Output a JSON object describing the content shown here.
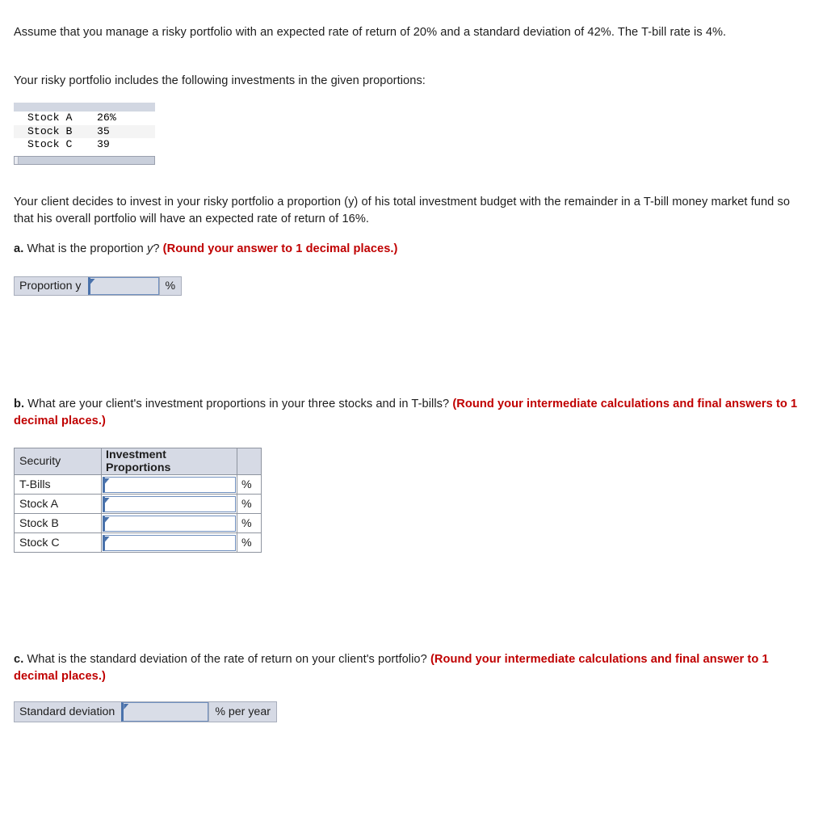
{
  "intro": {
    "paragraph1": "Assume that you manage a risky portfolio with an expected rate of return of 20% and a standard deviation of 42%. The T-bill rate is 4%.",
    "paragraph2": "Your risky portfolio includes the following investments in the given proportions:"
  },
  "portfolio_table": {
    "rows": [
      {
        "name": "Stock A",
        "value": "26%"
      },
      {
        "name": "Stock B",
        "value": "35"
      },
      {
        "name": "Stock C",
        "value": "39"
      }
    ]
  },
  "client_paragraph": "Your client decides to invest in your risky portfolio a proportion (y) of his total investment budget with the remainder in a T-bill money market fund so that his overall portfolio will have an expected rate of return of 16%.",
  "question_a": {
    "marker": "a.",
    "text_before": " What is the proportion ",
    "variable": "y",
    "text_after": "? ",
    "note": "(Round your answer to 1 decimal places.)",
    "answer": {
      "label": "Proportion y",
      "value": "",
      "unit": "%"
    }
  },
  "question_b": {
    "marker": "b.",
    "text": " What are your client's investment proportions in your three stocks and in T-bills? ",
    "note": "(Round your intermediate calculations and final answers to 1 decimal places.)",
    "table": {
      "headers": [
        "Security",
        "Investment Proportions",
        ""
      ],
      "rows": [
        {
          "security": "T-Bills",
          "proportion": "",
          "unit": "%"
        },
        {
          "security": "Stock A",
          "proportion": "",
          "unit": "%"
        },
        {
          "security": "Stock B",
          "proportion": "",
          "unit": "%"
        },
        {
          "security": "Stock C",
          "proportion": "",
          "unit": "%"
        }
      ]
    }
  },
  "question_c": {
    "marker": "c.",
    "text": " What is the standard deviation of the rate of return on your client's portfolio? ",
    "note": "(Round your intermediate calculations and final answer to 1 decimal places.)",
    "answer": {
      "label": "Standard deviation",
      "value": "",
      "unit": "% per year"
    }
  },
  "colors": {
    "note_red": "#c00000",
    "header_fill": "#d6dae5",
    "input_border": "#4a72ab",
    "body_text": "#1d1d1d"
  }
}
